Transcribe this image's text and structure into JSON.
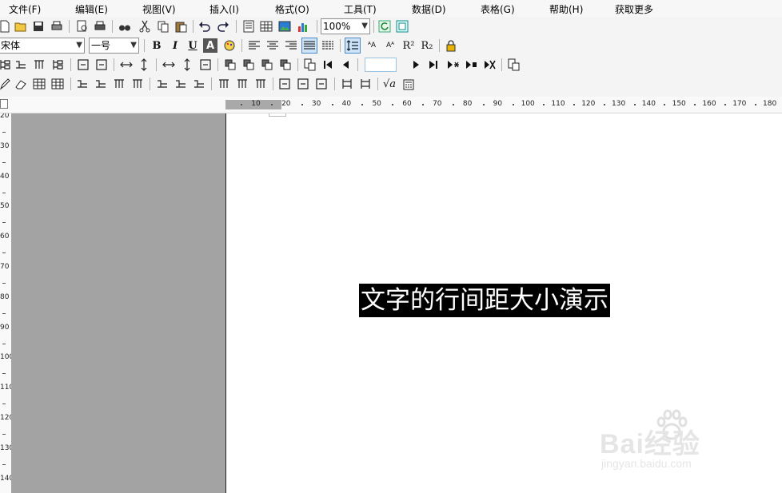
{
  "menubar": {
    "items": [
      "文件(F)",
      "编辑(E)",
      "视图(V)",
      "插入(I)",
      "格式(O)",
      "工具(T)",
      "数据(D)",
      "表格(G)",
      "帮助(H)",
      "获取更多"
    ]
  },
  "toolbar1": {
    "zoom_value": "100%"
  },
  "toolbar2": {
    "font_name": "宋体",
    "font_size": "一号",
    "bold_label": "B",
    "italic_label": "I",
    "underline_label": "U",
    "font_color_label": "A",
    "superscript_label": "R²",
    "subscript_label": "R₂"
  },
  "toolbar4": {
    "sqrt_label": "√a"
  },
  "ruler": {
    "horizontal_labels": [
      "10",
      "20",
      "30",
      "40",
      "50",
      "60",
      "70",
      "80",
      "90",
      "100",
      "110",
      "120",
      "130",
      "140",
      "150",
      "160",
      "170",
      "180"
    ],
    "vertical_labels": [
      "20",
      "30",
      "40",
      "50",
      "60",
      "70",
      "80",
      "90",
      "100",
      "110",
      "120",
      "130",
      "140"
    ]
  },
  "document": {
    "selected_text": "文字的行间距大小演示"
  },
  "watermark": {
    "logo_text": "Bai经验",
    "url_text": "jingyan.baidu.com"
  },
  "colors": {
    "workspace_grey": "#a3a3a3",
    "selection_bg": "#000000",
    "selection_fg": "#ffffff",
    "zoom_input_border": "#9bc4e2"
  }
}
